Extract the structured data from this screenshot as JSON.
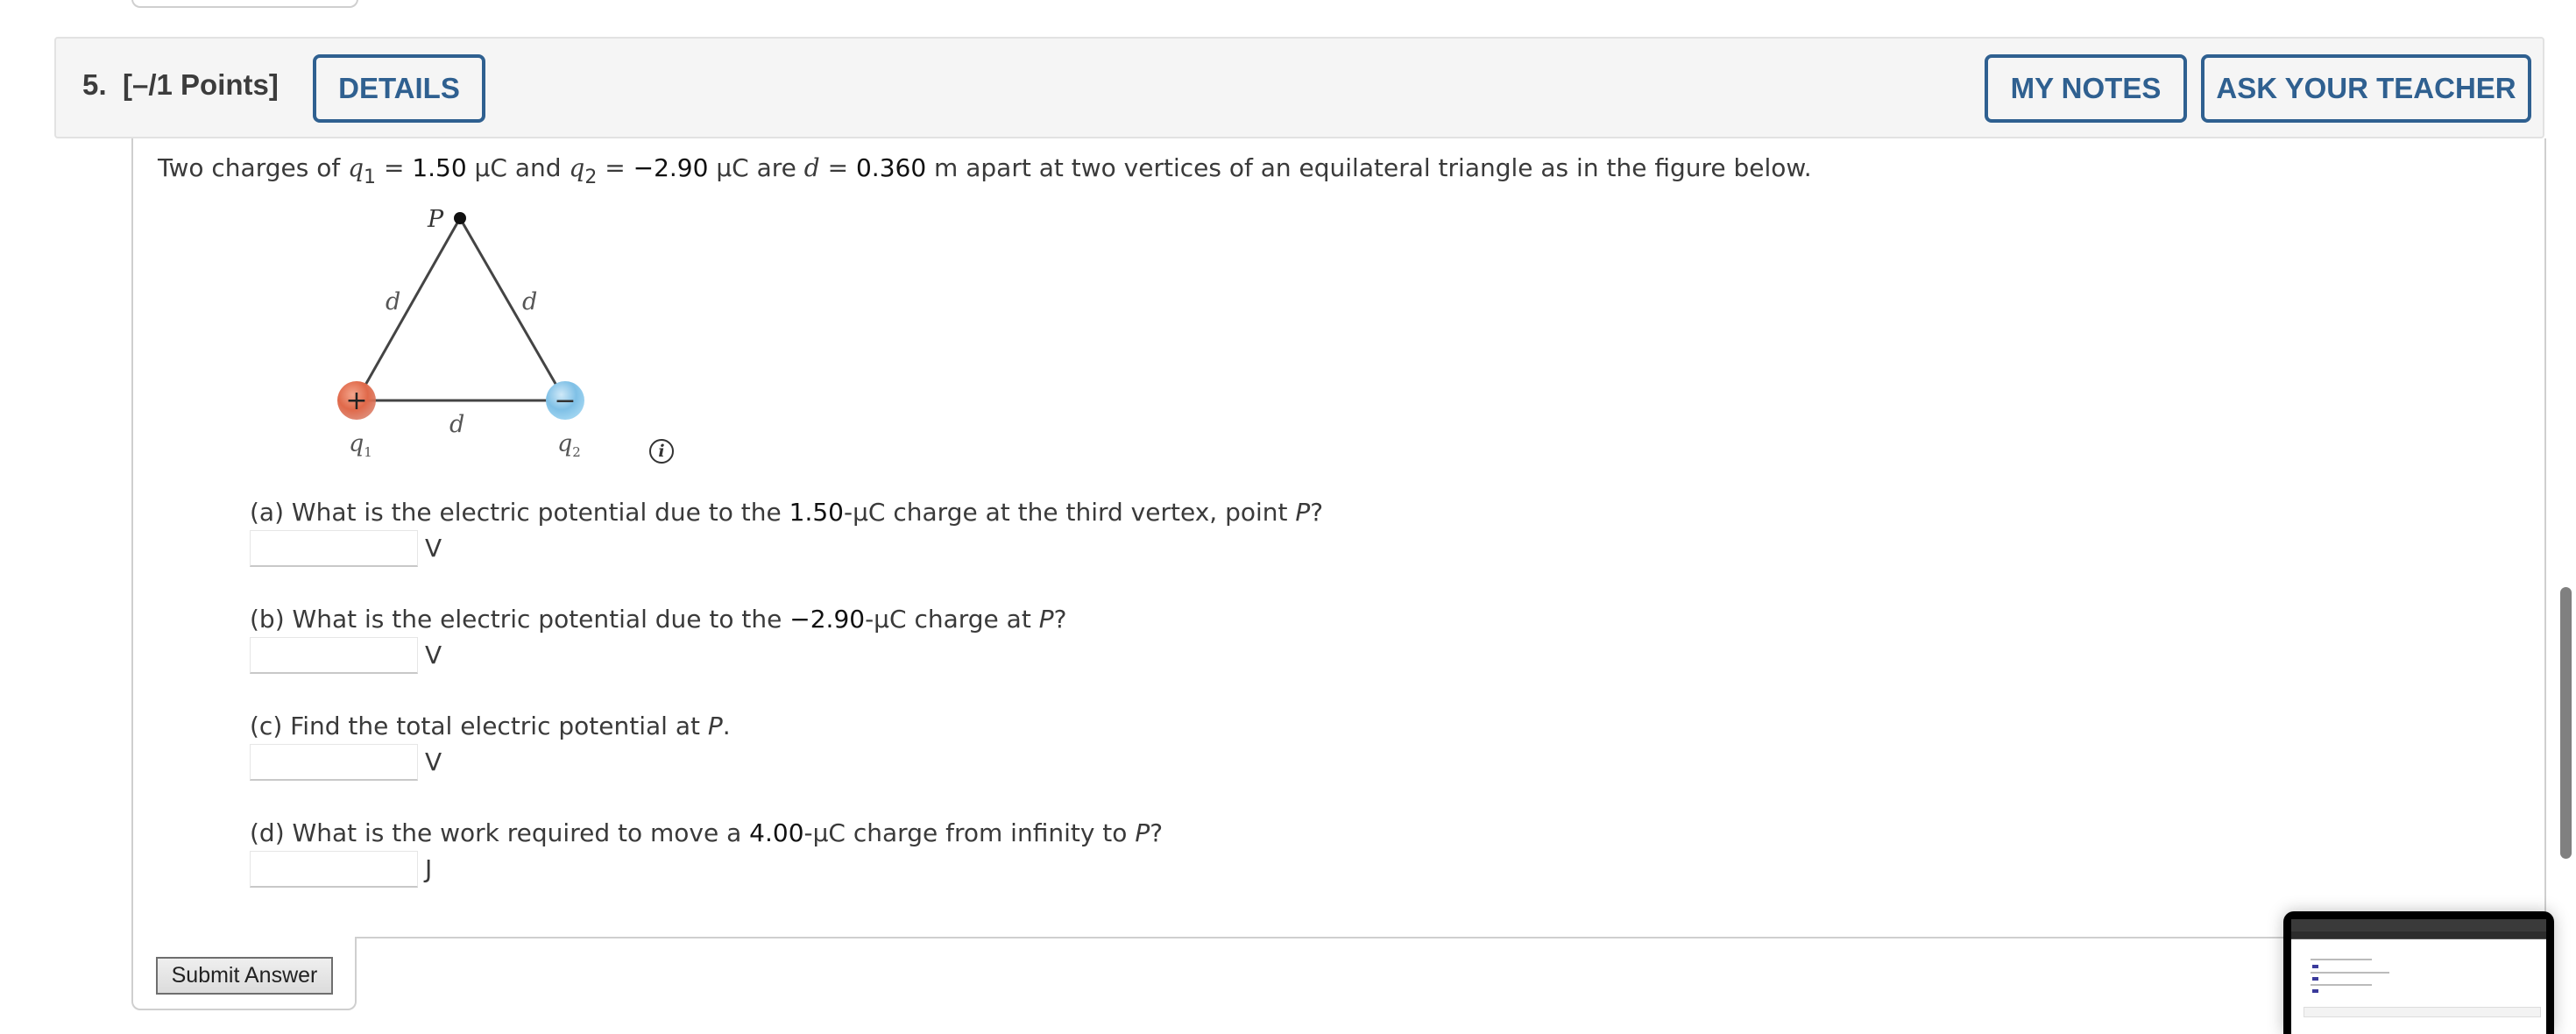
{
  "question": {
    "number": "5.",
    "points": "[–/1 Points]",
    "buttons": {
      "details": "DETAILS",
      "my_notes": "MY NOTES",
      "ask_teacher": "ASK YOUR TEACHER"
    },
    "accent_color": "#2f6090",
    "intro": {
      "t1": "Two charges of ",
      "q1_var": "q",
      "q1_sub": "1",
      "t2": " = ",
      "q1_val": "1.50",
      "t3": " μC and ",
      "q2_var": "q",
      "q2_sub": "2",
      "t4": " = ",
      "q2_val": "−2.90",
      "t5": " μC are ",
      "d_var": "d",
      "t6": " = ",
      "d_val": "0.360",
      "t7": " m apart at two vertices of an equilateral triangle as in the figure below."
    },
    "figure": {
      "vertex_label": "P",
      "side_label": "d",
      "q1_label": "q",
      "q1_sub": "1",
      "q2_label": "q",
      "q2_sub": "2",
      "q1_sign": "+",
      "q2_sign": "−",
      "q1_color": "#e0694a",
      "q2_color": "#7fc0e6"
    },
    "info_icon": "i",
    "parts": [
      {
        "prefix": "(a) What is the electric potential due to the ",
        "value": "1.50",
        "middle": "-μC charge at the third vertex, point ",
        "var": "P",
        "suffix": "?",
        "unit": "V",
        "answer": ""
      },
      {
        "prefix": "(b) What is the electric potential due to the ",
        "value": "−2.90",
        "middle": "-μC charge at ",
        "var": "P",
        "suffix": "?",
        "unit": "V",
        "answer": ""
      },
      {
        "prefix": "(c) Find the total electric potential at ",
        "value": "",
        "middle": "",
        "var": "P",
        "suffix": ".",
        "unit": "V",
        "answer": ""
      },
      {
        "prefix": "(d) What is the work required to move a ",
        "value": "4.00",
        "middle": "-μC charge from infinity to ",
        "var": "P",
        "suffix": "?",
        "unit": "J",
        "answer": ""
      }
    ],
    "submit_label": "Submit Answer"
  }
}
